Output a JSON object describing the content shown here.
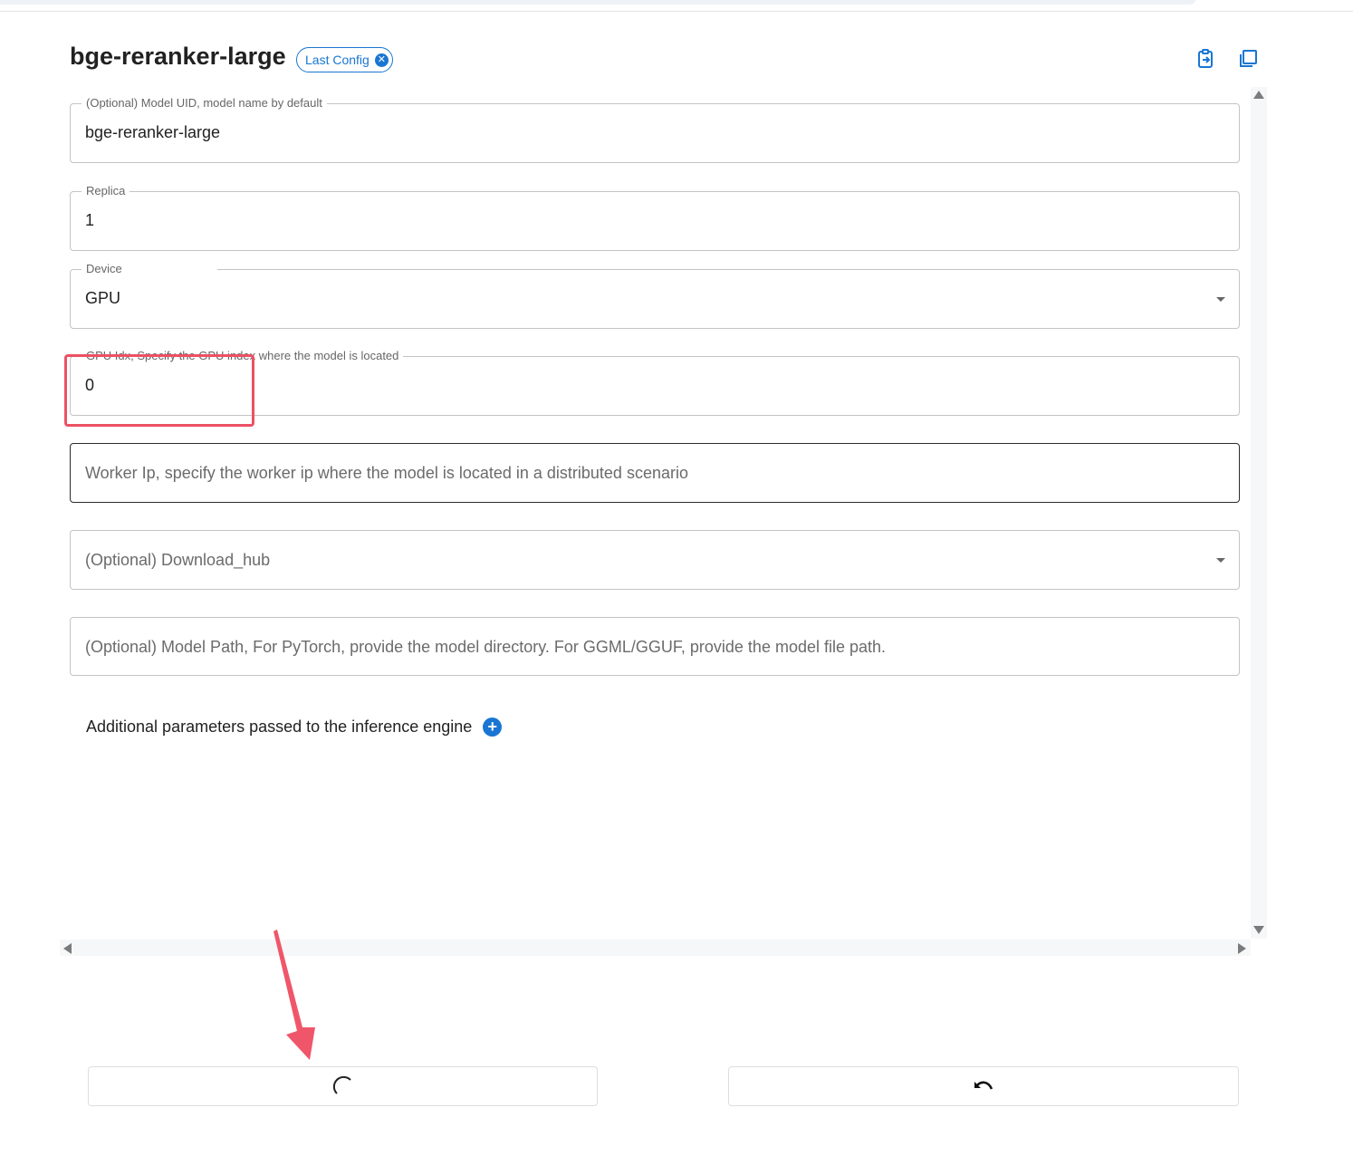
{
  "model": {
    "title": "bge-reranker-large",
    "chip_label": "Last Config",
    "chip_close_glyph": "✕"
  },
  "header_icons": [
    "copy-to-clipboard-icon",
    "copy-icon"
  ],
  "form": {
    "model_uid": {
      "label": "(Optional) Model UID, model name by default",
      "value": "bge-reranker-large"
    },
    "replica": {
      "label": "Replica",
      "value": "1"
    },
    "device": {
      "label": "Device",
      "value": "GPU"
    },
    "gpu_idx": {
      "label": "GPU Idx, Specify the GPU index where the model is located",
      "value": "0"
    },
    "worker_ip": {
      "placeholder": "Worker Ip, specify the worker ip where the model is located in a distributed scenario"
    },
    "download_hub": {
      "placeholder": "(Optional) Download_hub"
    },
    "model_path": {
      "placeholder": "(Optional) Model Path, For PyTorch, provide the model directory. For GGML/GGUF, provide the model file path."
    },
    "additional": {
      "label": "Additional parameters passed to the inference engine",
      "add_glyph": "+"
    }
  },
  "actions": {
    "launch_icon": "loading-spinner-icon",
    "reset_icon": "undo-icon"
  },
  "colors": {
    "accent": "#1976d2",
    "annotation": "#ec5164"
  }
}
